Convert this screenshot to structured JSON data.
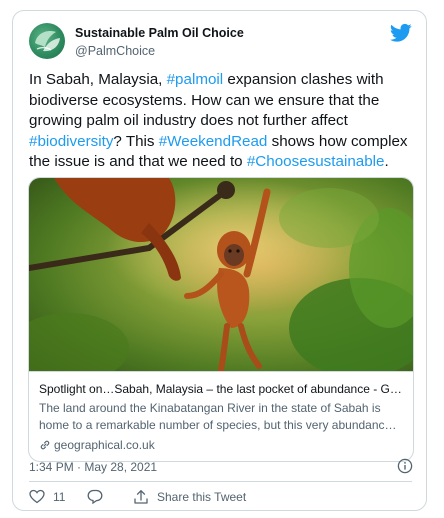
{
  "author": {
    "name": "Sustainable Palm Oil Choice",
    "handle": "@PalmChoice",
    "avatar_icon": "leaf-globe-logo"
  },
  "brand_icon": "twitter-bird-icon",
  "tweet": {
    "segments": [
      {
        "text": "In Sabah, Malaysia, ",
        "tag": false
      },
      {
        "text": "#palmoil",
        "tag": true
      },
      {
        "text": " expansion clashes with biodiverse ecosystems. How can we ensure that the growing palm oil industry does not further affect ",
        "tag": false
      },
      {
        "text": "#biodiversity",
        "tag": true
      },
      {
        "text": "? This ",
        "tag": false
      },
      {
        "text": "#WeekendRead",
        "tag": true
      },
      {
        "text": " shows how complex the issue is and that we need to ",
        "tag": false
      },
      {
        "text": "#Choosesustainable",
        "tag": true
      },
      {
        "text": ".",
        "tag": false
      }
    ]
  },
  "link_card": {
    "title": "Spotlight on…Sabah, Malaysia – the last pocket of abundance - Geograp...",
    "description": "The land around the Kinabatangan River in the state of Sabah is home to a remarkable number of species, but this very abundance is threatened ...",
    "domain": "geographical.co.uk",
    "image_alt": "orangutan-photo"
  },
  "timestamp": "1:34 PM · May 28, 2021",
  "actions": {
    "like_count": "11",
    "share_label": "Share this Tweet"
  },
  "colors": {
    "link_blue": "#1d9bf0",
    "text_primary": "#0f1419",
    "text_secondary": "#536471",
    "border": "#cfd9de"
  }
}
